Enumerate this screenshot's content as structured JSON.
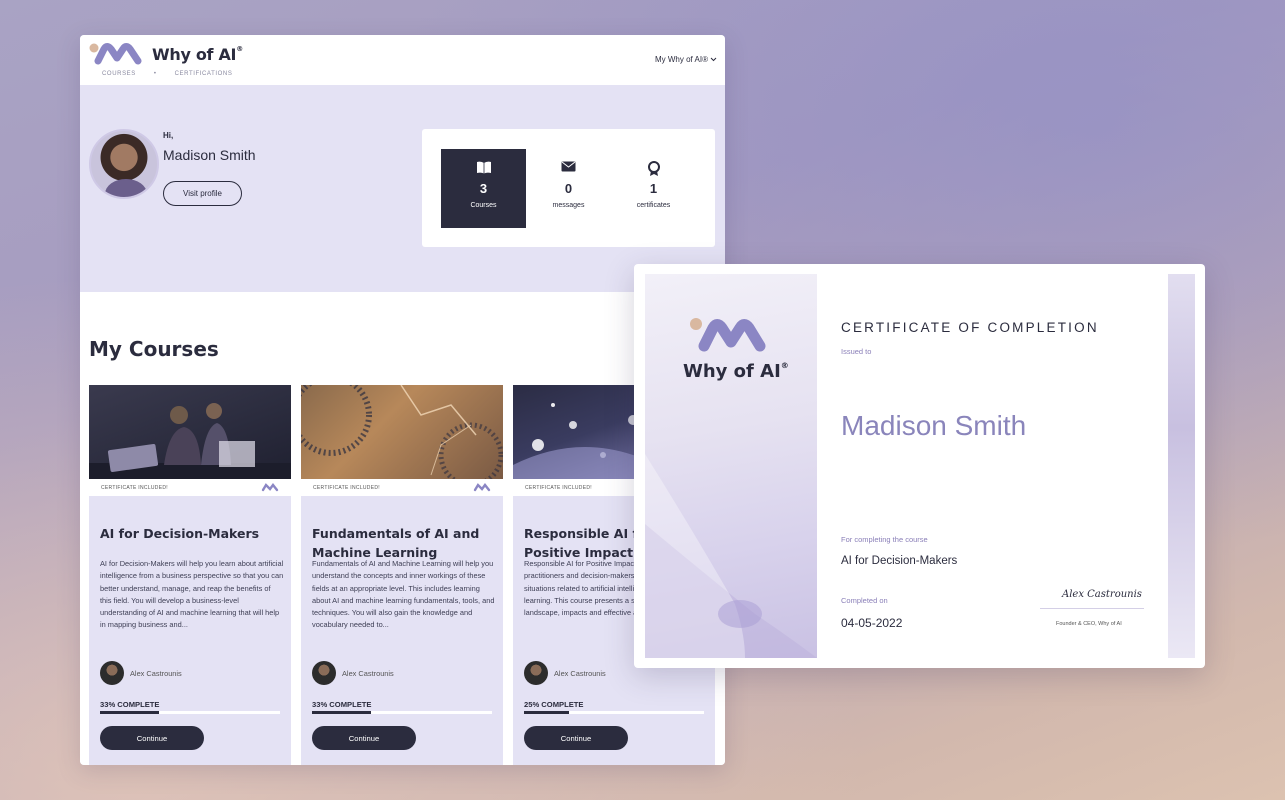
{
  "dashboard": {
    "brand": "Why of AI",
    "brand_mark": "®",
    "nav": {
      "courses": "COURSES",
      "separator": "•",
      "certifications": "CERTIFICATIONS"
    },
    "account_menu": "My Why of AI®",
    "greeting": "Hi,",
    "user_name": "Madison Smith",
    "visit_profile": "Visit profile",
    "stats": [
      {
        "icon": "book-icon",
        "count": "3",
        "label": "Courses"
      },
      {
        "icon": "envelope-icon",
        "count": "0",
        "label": "messages"
      },
      {
        "icon": "award-icon",
        "count": "1",
        "label": "certificates"
      }
    ],
    "section_title": "My Courses",
    "courses": [
      {
        "badge": "CERTIFICATE INCLUDED!",
        "title": "AI for Decision-Makers",
        "description": "AI for Decision-Makers will help you learn about artificial intelligence from a business perspective so that you can better understand, manage, and reap the benefits of this field. You will develop a business-level understanding of AI and machine learning that will help in mapping business and...",
        "instructor": "Alex Castrounis",
        "progress_label": "33% COMPLETE",
        "progress": 0.33,
        "button": "Continue"
      },
      {
        "badge": "CERTIFICATE INCLUDED!",
        "title": "Fundamentals of AI and Machine Learning",
        "description": "Fundamentals of AI and Machine Learning will help you understand the concepts and inner workings of these fields at an appropriate level. This includes learning about AI and machine learning fundamentals, tools, and techniques. You will also gain the knowledge and vocabulary needed to...",
        "instructor": "Alex Castrounis",
        "progress_label": "33% COMPLETE",
        "progress": 0.33,
        "button": "Continue"
      },
      {
        "badge": "CERTIFICATE INCLUDED!",
        "title": "Responsible AI for Positive Impact",
        "description": "Responsible AI for Positive Impact will inform practitioners and decision-makers in a wide variety of situations related to artificial intelligence and machine learning. This course presents a survey of the current landscape, impacts and effective approaches...",
        "instructor": "Alex Castrounis",
        "progress_label": "25% COMPLETE",
        "progress": 0.25,
        "button": "Continue"
      }
    ]
  },
  "certificate": {
    "brand": "Why of AI",
    "brand_mark": "®",
    "heading": "CERTIFICATE OF COMPLETION",
    "issued_to_label": "Issued to",
    "recipient": "Madison Smith",
    "for_label": "For completing the course",
    "course": "AI for Decision-Makers",
    "completed_label": "Completed on",
    "completed_date": "04-05-2022",
    "signature": "Alex Castrounis",
    "signer_title": "Founder & CEO, Why of AI"
  },
  "colors": {
    "navy": "#2b2c3e",
    "lavender": "#e4e2f4",
    "accent": "#8a85bb",
    "logo_purple": "#8b86c4",
    "logo_peach": "#d9b8a0"
  }
}
